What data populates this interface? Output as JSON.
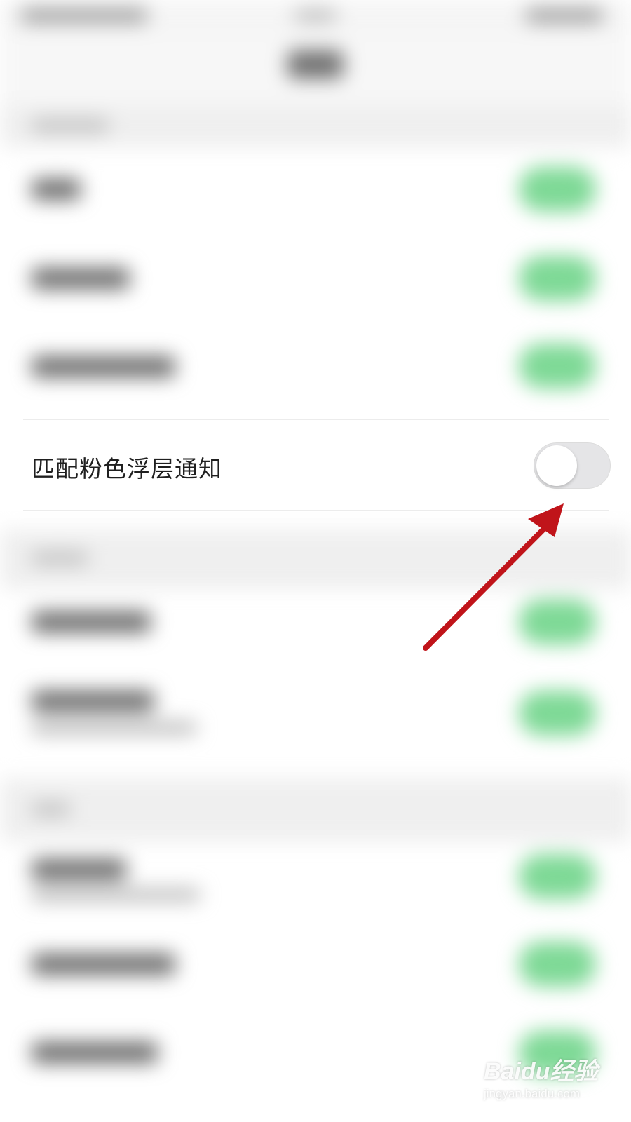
{
  "setting_row": {
    "label": "匹配粉色浮层通知",
    "toggle_state": "off"
  },
  "watermark": {
    "logo_text": "Baidu经验",
    "url_text": "jingyan.baidu.com"
  },
  "colors": {
    "arrow": "#c0141a",
    "toggle_off_track": "#e5e5e7",
    "toggle_on_track": "#7ed996",
    "label_text": "#1f1f1f"
  },
  "icons": {
    "annotation": "red-arrow-icon",
    "watermark": "baidu-paw-icon"
  }
}
